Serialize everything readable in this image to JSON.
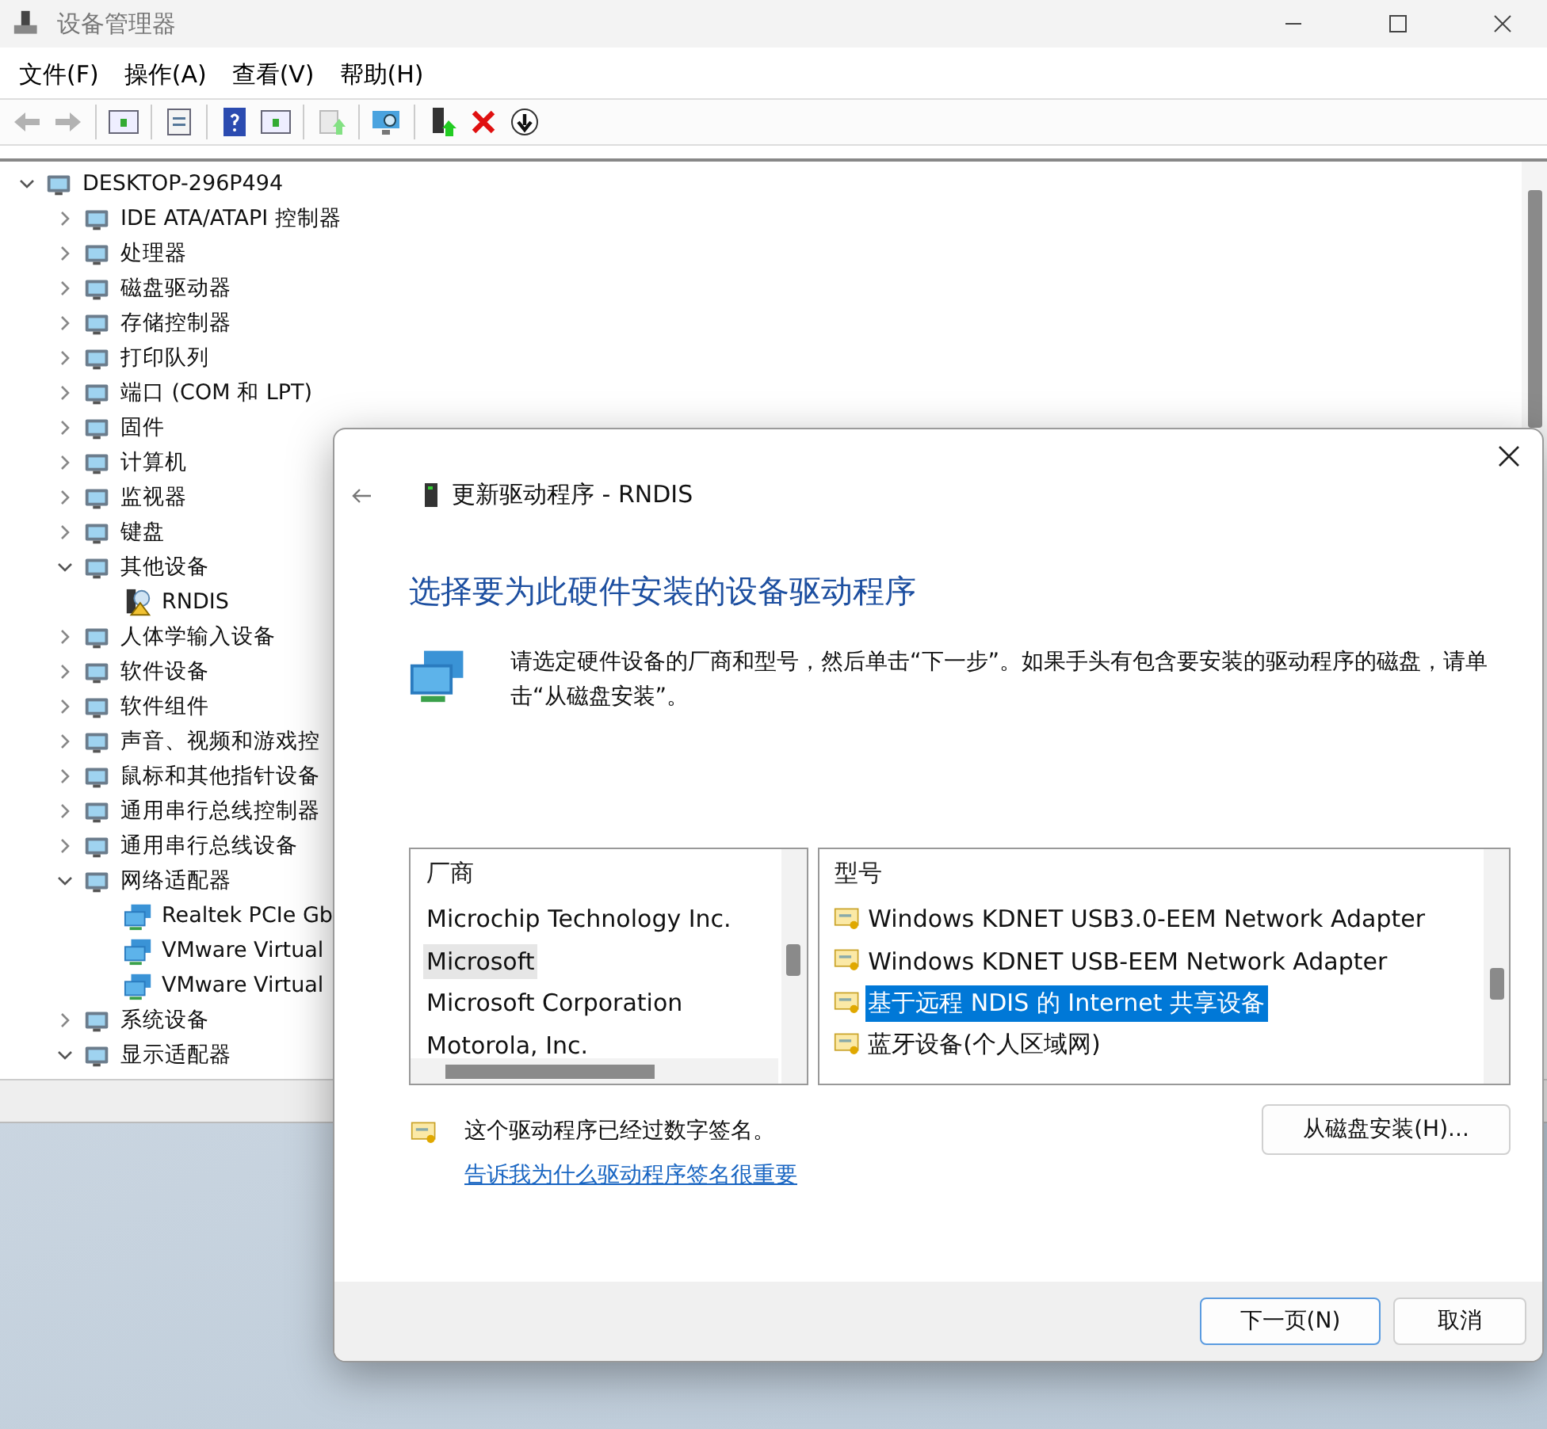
{
  "window": {
    "title": "设备管理器"
  },
  "menu": [
    {
      "label": "文件(F)"
    },
    {
      "label": "操作(A)"
    },
    {
      "label": "查看(V)"
    },
    {
      "label": "帮助(H)"
    }
  ],
  "toolbar": [
    {
      "kind": "back",
      "disabled": true
    },
    {
      "kind": "forward",
      "disabled": true
    },
    {
      "kind": "sep"
    },
    {
      "kind": "panel",
      "disabled": false
    },
    {
      "kind": "sep"
    },
    {
      "kind": "props",
      "disabled": false
    },
    {
      "kind": "sep"
    },
    {
      "kind": "help",
      "disabled": false
    },
    {
      "kind": "panel2",
      "disabled": false
    },
    {
      "kind": "sep"
    },
    {
      "kind": "update",
      "disabled": true
    },
    {
      "kind": "sep"
    },
    {
      "kind": "scan",
      "disabled": false
    },
    {
      "kind": "sep"
    },
    {
      "kind": "add",
      "disabled": false
    },
    {
      "kind": "remove",
      "disabled": false
    },
    {
      "kind": "download",
      "disabled": false
    }
  ],
  "tree": {
    "label": "DESKTOP-296P494",
    "expanded": true,
    "children": [
      {
        "label": "IDE ATA/ATAPI 控制器",
        "expanded": false
      },
      {
        "label": "处理器",
        "expanded": false
      },
      {
        "label": "磁盘驱动器",
        "expanded": false
      },
      {
        "label": "存储控制器",
        "expanded": false
      },
      {
        "label": "打印队列",
        "expanded": false
      },
      {
        "label": "端口 (COM 和 LPT)",
        "expanded": false
      },
      {
        "label": "固件",
        "expanded": false
      },
      {
        "label": "计算机",
        "expanded": false
      },
      {
        "label": "监视器",
        "expanded": false
      },
      {
        "label": "键盘",
        "expanded": false
      },
      {
        "label": "其他设备",
        "expanded": true,
        "children": [
          {
            "label": "RNDIS",
            "warning": true
          }
        ]
      },
      {
        "label": "人体学输入设备",
        "expanded": false
      },
      {
        "label": "软件设备",
        "expanded": false
      },
      {
        "label": "软件组件",
        "expanded": false
      },
      {
        "label": "声音、视频和游戏控",
        "expanded": false
      },
      {
        "label": "鼠标和其他指针设备",
        "expanded": false
      },
      {
        "label": "通用串行总线控制器",
        "expanded": false
      },
      {
        "label": "通用串行总线设备",
        "expanded": false
      },
      {
        "label": "网络适配器",
        "expanded": true,
        "children": [
          {
            "label": "Realtek PCIe Gb",
            "warning": false
          },
          {
            "label": "VMware Virtual",
            "warning": false
          },
          {
            "label": "VMware Virtual",
            "warning": false
          }
        ]
      },
      {
        "label": "系统设备",
        "expanded": false
      },
      {
        "label": "显示适配器",
        "expanded": true
      }
    ]
  },
  "dialog": {
    "title": "更新驱动程序 - RNDIS",
    "heading": "选择要为此硬件安装的设备驱动程序",
    "description": "请选定硬件设备的厂商和型号，然后单击“下一步”。如果手头有包含要安装的驱动程序的磁盘，请单击“从磁盘安装”。",
    "manufacturers": {
      "header": "厂商",
      "items": [
        {
          "label": "Microchip Technology Inc.",
          "selected": false
        },
        {
          "label": "Microsoft",
          "selected": true
        },
        {
          "label": "Microsoft Corporation",
          "selected": false
        },
        {
          "label": "Motorola, Inc.",
          "selected": false
        }
      ]
    },
    "models": {
      "header": "型号",
      "items": [
        {
          "label": "Windows KDNET USB3.0-EEM Network Adapter",
          "selected": false
        },
        {
          "label": "Windows KDNET USB-EEM Network Adapter",
          "selected": false
        },
        {
          "label": "基于远程 NDIS 的 Internet 共享设备",
          "selected": true
        },
        {
          "label": "蓝牙设备(个人区域网)",
          "selected": false
        }
      ]
    },
    "signed_note": "这个驱动程序已经过数字签名。",
    "link": "告诉我为什么驱动程序签名很重要",
    "disk_button": "从磁盘安装(H)...",
    "buttons": [
      {
        "label": "下一页(N)",
        "default": true
      },
      {
        "label": "取消",
        "default": false
      }
    ]
  }
}
